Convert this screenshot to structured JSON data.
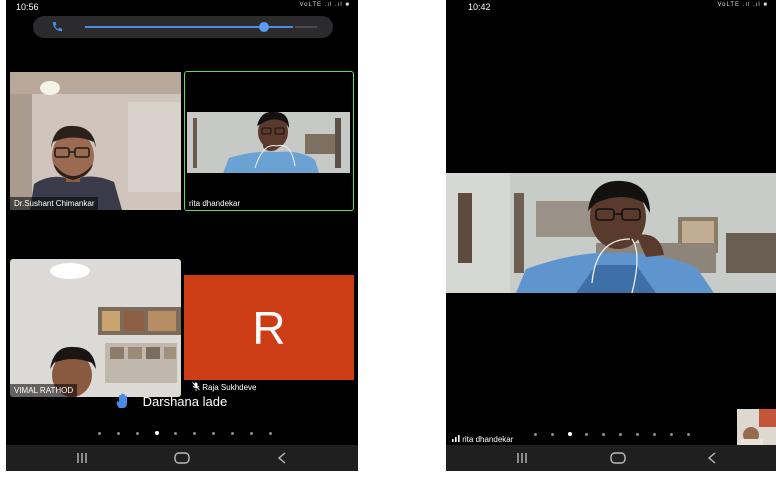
{
  "left_screen": {
    "status_time": "10:56",
    "status_net": "VoLTE .ıl .ıl ■",
    "participants": [
      {
        "name": "Dr.Sushant Chimankar"
      },
      {
        "name": "rita dhandekar"
      },
      {
        "name": "VIMAL RATHOD"
      },
      {
        "name": "Raja Sukhdeve",
        "avatar_letter": "R",
        "avatar_color": "#cc3d16",
        "muted": true
      }
    ],
    "raised_hand_name": "Darshana lade",
    "page_count": 10,
    "active_page": 3,
    "call_bar": {
      "volume_level": 0.86,
      "accent": "#4a8be8"
    }
  },
  "right_screen": {
    "status_time": "10:42",
    "status_net": "VoLTE .ıl .ıl ■",
    "speaker_name": "rita dhandekar",
    "page_count": 10,
    "active_page": 2
  },
  "colors": {
    "active_speaker_border": "#5fdc5f",
    "raise_hand": "#4a8be8"
  },
  "icons": [
    "phone-icon",
    "raise-hand-icon",
    "mic-muted-icon",
    "signal-icon",
    "recents-nav-icon",
    "home-nav-icon",
    "back-nav-icon"
  ]
}
